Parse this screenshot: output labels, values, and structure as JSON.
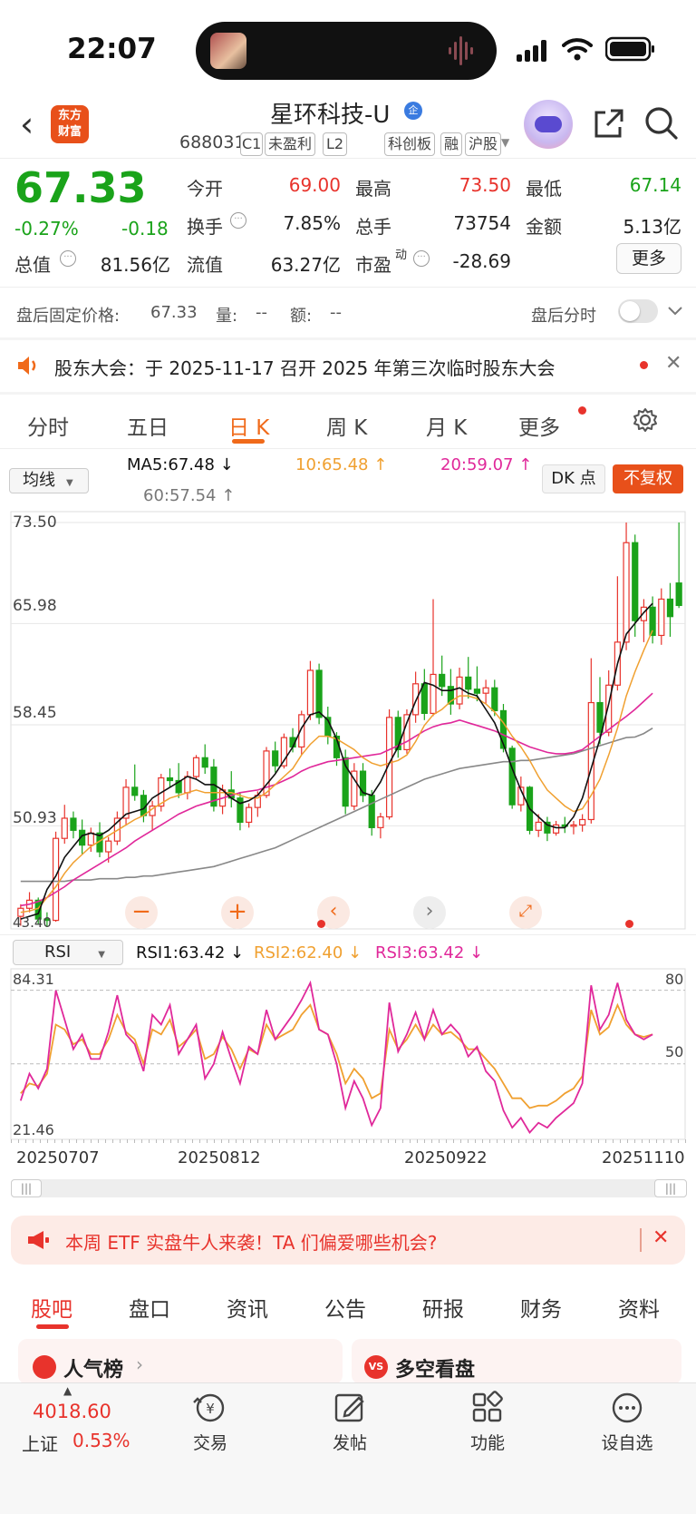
{
  "status_bar": {
    "time": "22:07"
  },
  "header": {
    "back": "‹",
    "logo_line1": "东方",
    "logo_line2": "财富",
    "title": "星环科技-U",
    "title_badge": "企",
    "code": "688031",
    "tags": [
      "C1",
      "未盈利",
      "L2",
      "科创板",
      "融",
      "沪股"
    ]
  },
  "quote": {
    "price": "67.33",
    "change_pct": "-0.27%",
    "change": "-0.18",
    "open_label": "今开",
    "open": "69.00",
    "high_label": "最高",
    "high": "73.50",
    "low_label": "最低",
    "low": "67.14",
    "turnover_label": "换手",
    "turnover": "7.85%",
    "volume_label": "总手",
    "volume": "73754",
    "amount_label": "金额",
    "amount": "5.13亿",
    "mktcap_label": "总值",
    "mktcap": "81.56亿",
    "float_label": "流值",
    "float_cap": "63.27亿",
    "pe_label": "市盈",
    "pe_sup": "动",
    "pe": "-28.69",
    "more": "更多"
  },
  "after_hours": {
    "price_label": "盘后固定价格:",
    "price": "67.33",
    "vol_label": "量:",
    "vol": "--",
    "amt_label": "额:",
    "amt": "--",
    "intraday_label": "盘后分时"
  },
  "notice": {
    "text": "股东大会：于 2025-11-17 召开 2025 年第三次临时股东大会"
  },
  "chart_tabs": [
    "分时",
    "五日",
    "日 K",
    "周 K",
    "月 K",
    "更多"
  ],
  "ma_bar": {
    "selector": "均线",
    "ma5": "MA5:67.48 ↓",
    "ma10": "10:65.48 ↑",
    "ma20": "20:59.07 ↑",
    "ma60": "60:57.54 ↑",
    "dk": "DK 点",
    "fq": "不复权"
  },
  "price_axis": [
    "73.50",
    "65.98",
    "58.45",
    "50.93",
    "43.40"
  ],
  "rsi_bar": {
    "selector": "RSI",
    "rsi1": "RSI1:63.42 ↓",
    "rsi2": "RSI2:62.40 ↓",
    "rsi3": "RSI3:63.42 ↓"
  },
  "rsi_axis": {
    "top": "84.31",
    "bottom": "21.46",
    "r80": "80",
    "r50": "50"
  },
  "dates": [
    "20250707",
    "20250812",
    "20250922",
    "20251110"
  ],
  "banner": {
    "text": "本周 ETF 实盘牛人来袭！TA 们偏爱哪些机会?"
  },
  "bottom_tabs": [
    "股吧",
    "盘口",
    "资讯",
    "公告",
    "研报",
    "财务",
    "资料"
  ],
  "cards": {
    "left": "人气榜",
    "right": "多空看盘"
  },
  "index": {
    "value": "4018.60",
    "name": "上证",
    "pct": "0.53%"
  },
  "nav": [
    "交易",
    "发帖",
    "功能",
    "设自选"
  ],
  "colors": {
    "up": "#e8332c",
    "down": "#1aa31a",
    "accent": "#f06a1a",
    "ma10": "#f0a030",
    "ma20": "#e0289a",
    "ma60": "#888888"
  },
  "chart_data": {
    "type": "candlestick",
    "ylim": [
      43.4,
      73.5
    ],
    "candles": [
      [
        44.2,
        45.1,
        43.5,
        44.8
      ],
      [
        44.8,
        46.0,
        44.5,
        45.4
      ],
      [
        45.4,
        45.6,
        43.6,
        44.0
      ],
      [
        44.0,
        44.5,
        43.4,
        43.9
      ],
      [
        43.9,
        50.5,
        43.8,
        50.0
      ],
      [
        50.0,
        52.5,
        49.6,
        51.5
      ],
      [
        51.5,
        52.0,
        50.0,
        50.6
      ],
      [
        50.6,
        51.4,
        48.8,
        49.5
      ],
      [
        49.5,
        50.8,
        49.0,
        50.4
      ],
      [
        50.4,
        51.2,
        48.6,
        49.0
      ],
      [
        49.0,
        50.1,
        48.2,
        49.8
      ],
      [
        49.8,
        52.0,
        49.5,
        51.5
      ],
      [
        51.5,
        54.4,
        51.0,
        53.8
      ],
      [
        53.8,
        55.5,
        52.8,
        53.2
      ],
      [
        53.2,
        53.6,
        51.2,
        51.7
      ],
      [
        51.7,
        52.8,
        50.6,
        52.4
      ],
      [
        52.4,
        54.8,
        52.0,
        54.5
      ],
      [
        54.5,
        55.2,
        53.8,
        54.3
      ],
      [
        54.3,
        55.6,
        53.0,
        53.4
      ],
      [
        53.4,
        55.0,
        52.9,
        54.6
      ],
      [
        54.6,
        56.2,
        54.4,
        56.0
      ],
      [
        56.0,
        57.0,
        54.8,
        55.3
      ],
      [
        55.3,
        55.9,
        52.0,
        52.4
      ],
      [
        52.4,
        54.0,
        51.8,
        53.6
      ],
      [
        53.6,
        55.0,
        52.3,
        53.0
      ],
      [
        53.0,
        53.4,
        50.6,
        51.2
      ],
      [
        51.2,
        52.6,
        50.8,
        52.3
      ],
      [
        52.3,
        53.5,
        51.6,
        53.2
      ],
      [
        53.2,
        56.8,
        53.0,
        56.5
      ],
      [
        56.5,
        57.2,
        54.9,
        55.4
      ],
      [
        55.4,
        57.8,
        55.2,
        57.5
      ],
      [
        57.5,
        58.2,
        56.4,
        56.8
      ],
      [
        56.8,
        59.5,
        56.2,
        59.2
      ],
      [
        59.2,
        63.2,
        58.8,
        62.5
      ],
      [
        62.5,
        63.0,
        58.5,
        59.0
      ],
      [
        59.0,
        59.8,
        57.0,
        57.6
      ],
      [
        57.6,
        57.9,
        55.4,
        56.0
      ],
      [
        56.0,
        56.6,
        51.8,
        52.4
      ],
      [
        52.4,
        55.6,
        52.1,
        55.0
      ],
      [
        55.0,
        55.6,
        52.7,
        53.2
      ],
      [
        53.2,
        53.6,
        50.2,
        50.8
      ],
      [
        50.8,
        51.9,
        50.0,
        51.6
      ],
      [
        51.6,
        59.6,
        51.4,
        59.0
      ],
      [
        59.0,
        59.5,
        56.0,
        56.6
      ],
      [
        56.6,
        59.6,
        56.3,
        59.2
      ],
      [
        59.2,
        62.4,
        58.6,
        61.5
      ],
      [
        61.5,
        62.6,
        58.8,
        59.3
      ],
      [
        59.3,
        67.8,
        59.1,
        62.2
      ],
      [
        62.2,
        63.6,
        60.6,
        61.3
      ],
      [
        61.3,
        62.6,
        59.2,
        60.0
      ],
      [
        60.0,
        62.7,
        59.6,
        62.0
      ],
      [
        62.0,
        63.5,
        60.4,
        61.1
      ],
      [
        61.1,
        62.8,
        60.2,
        60.8
      ],
      [
        60.8,
        61.8,
        60.0,
        61.2
      ],
      [
        61.2,
        61.8,
        59.1,
        59.5
      ],
      [
        59.5,
        60.0,
        56.4,
        56.7
      ],
      [
        56.7,
        56.9,
        52.2,
        52.5
      ],
      [
        52.5,
        54.6,
        52.0,
        53.8
      ],
      [
        53.8,
        53.9,
        50.3,
        50.6
      ],
      [
        50.6,
        51.8,
        50.1,
        51.2
      ],
      [
        51.2,
        51.6,
        49.8,
        50.4
      ],
      [
        50.4,
        51.3,
        50.2,
        51.0
      ],
      [
        51.0,
        51.6,
        50.4,
        50.9
      ],
      [
        50.9,
        51.3,
        50.3,
        51.0
      ],
      [
        51.0,
        51.8,
        50.5,
        51.4
      ],
      [
        51.4,
        63.4,
        51.1,
        60.1
      ],
      [
        60.1,
        62.0,
        57.0,
        57.9
      ],
      [
        57.9,
        62.5,
        57.6,
        61.4
      ],
      [
        61.4,
        69.5,
        61.0,
        64.6
      ],
      [
        64.6,
        73.5,
        64.0,
        72.0
      ],
      [
        72.0,
        72.6,
        65.0,
        66.2
      ],
      [
        66.2,
        67.8,
        64.6,
        67.2
      ],
      [
        67.2,
        68.0,
        64.5,
        65.1
      ],
      [
        65.1,
        68.6,
        64.4,
        67.8
      ],
      [
        67.8,
        69.0,
        65.0,
        66.5
      ],
      [
        69.0,
        73.5,
        67.14,
        67.33
      ]
    ],
    "rsi1": [
      35,
      46,
      40,
      48,
      80,
      68,
      56,
      62,
      52,
      52,
      63,
      78,
      62,
      58,
      47,
      70,
      66,
      74,
      54,
      60,
      66,
      44,
      50,
      63,
      52,
      42,
      57,
      54,
      72,
      60,
      65,
      70,
      76,
      83,
      64,
      62,
      50,
      32,
      43,
      36,
      25,
      32,
      75,
      55,
      62,
      71,
      60,
      72,
      62,
      66,
      62,
      53,
      57,
      47,
      43,
      31,
      24,
      28,
      22,
      26,
      24,
      28,
      31,
      34,
      42,
      82,
      64,
      70,
      83,
      68,
      62,
      60,
      62
    ],
    "rsi2": [
      38,
      42,
      41,
      46,
      66,
      64,
      58,
      60,
      54,
      54,
      60,
      70,
      63,
      60,
      50,
      64,
      62,
      68,
      57,
      60,
      64,
      52,
      54,
      61,
      56,
      48,
      56,
      54,
      66,
      60,
      62,
      64,
      70,
      74,
      64,
      62,
      54,
      42,
      48,
      44,
      36,
      38,
      64,
      56,
      60,
      66,
      60,
      66,
      62,
      63,
      60,
      56,
      56,
      52,
      48,
      42,
      36,
      36,
      32,
      33,
      33,
      35,
      38,
      40,
      45,
      72,
      62,
      65,
      74,
      66,
      62,
      61,
      62
    ],
    "ma5": [
      44.0,
      44.2,
      44.4,
      46.2,
      47.2,
      48.6,
      49.4,
      50.2,
      50.4,
      50.2,
      50.6,
      51.2,
      51.8,
      52.0,
      52.2,
      53.0,
      53.4,
      53.8,
      54.2,
      54.6,
      54.4,
      54.0,
      54.0,
      53.6,
      53.0,
      52.6,
      52.8,
      53.2,
      54.0,
      54.8,
      55.8,
      56.8,
      58.2,
      59.2,
      59.4,
      58.8,
      57.4,
      55.4,
      54.4,
      53.4,
      53.2,
      54.2,
      55.6,
      56.8,
      58.6,
      60.2,
      61.6,
      61.4,
      61.0,
      61.0,
      61.2,
      60.8,
      60.6,
      59.6,
      58.6,
      57.0,
      55.2,
      53.6,
      52.2,
      51.6,
      51.0,
      50.8,
      50.8,
      51.6,
      53.0,
      55.2,
      57.4,
      60.0,
      63.0,
      65.2,
      66.0,
      66.8,
      67.48
    ],
    "ma10": [
      44.5,
      44.6,
      44.8,
      45.6,
      46.4,
      47.4,
      48.2,
      48.8,
      49.4,
      49.8,
      50.2,
      50.6,
      51.0,
      51.4,
      51.7,
      52.2,
      52.6,
      53.0,
      53.2,
      53.4,
      53.6,
      53.4,
      53.4,
      53.4,
      53.4,
      53.2,
      53.0,
      53.0,
      53.4,
      54.0,
      54.6,
      55.2,
      56.2,
      57.0,
      57.6,
      57.6,
      57.4,
      57.0,
      56.6,
      56.0,
      55.6,
      55.4,
      55.6,
      55.8,
      56.2,
      57.2,
      58.4,
      59.2,
      59.6,
      60.2,
      60.6,
      60.6,
      60.4,
      60.0,
      59.4,
      58.6,
      57.6,
      56.8,
      55.8,
      54.6,
      53.6,
      53.0,
      52.4,
      52.0,
      52.2,
      53.2,
      54.4,
      56.2,
      58.2,
      60.6,
      62.4,
      64.0,
      65.48
    ],
    "ma20": [
      45.0,
      45.1,
      45.3,
      45.6,
      46.0,
      46.4,
      46.9,
      47.3,
      47.7,
      48.1,
      48.5,
      48.9,
      49.3,
      49.8,
      50.2,
      50.6,
      51.0,
      51.4,
      51.8,
      52.1,
      52.4,
      52.6,
      52.8,
      53.0,
      53.2,
      53.4,
      53.5,
      53.6,
      53.8,
      54.0,
      54.3,
      54.6,
      55.0,
      55.3,
      55.5,
      55.7,
      55.8,
      55.9,
      56.0,
      56.1,
      56.2,
      56.3,
      56.6,
      56.9,
      57.2,
      57.6,
      58.0,
      58.3,
      58.5,
      58.6,
      58.8,
      58.6,
      58.4,
      58.2,
      58.0,
      57.7,
      57.4,
      57.1,
      56.8,
      56.6,
      56.4,
      56.3,
      56.3,
      56.4,
      56.6,
      57.1,
      57.6,
      58.1,
      58.6,
      59.07,
      59.6,
      60.2,
      60.8
    ],
    "ma60": [
      46.8,
      46.8,
      46.8,
      46.8,
      46.8,
      46.8,
      46.9,
      46.9,
      46.9,
      47.0,
      47.0,
      47.0,
      47.1,
      47.1,
      47.2,
      47.2,
      47.3,
      47.4,
      47.5,
      47.6,
      47.7,
      47.8,
      47.9,
      48.1,
      48.3,
      48.5,
      48.7,
      48.9,
      49.1,
      49.3,
      49.6,
      49.9,
      50.2,
      50.5,
      50.8,
      51.1,
      51.4,
      51.7,
      52.0,
      52.3,
      52.6,
      52.9,
      53.2,
      53.5,
      53.8,
      54.1,
      54.4,
      54.6,
      54.8,
      55.0,
      55.2,
      55.3,
      55.4,
      55.5,
      55.6,
      55.7,
      55.7,
      55.8,
      55.8,
      55.9,
      56.0,
      56.1,
      56.2,
      56.3,
      56.5,
      56.7,
      56.9,
      57.1,
      57.3,
      57.5,
      57.54,
      57.8,
      58.2
    ]
  }
}
